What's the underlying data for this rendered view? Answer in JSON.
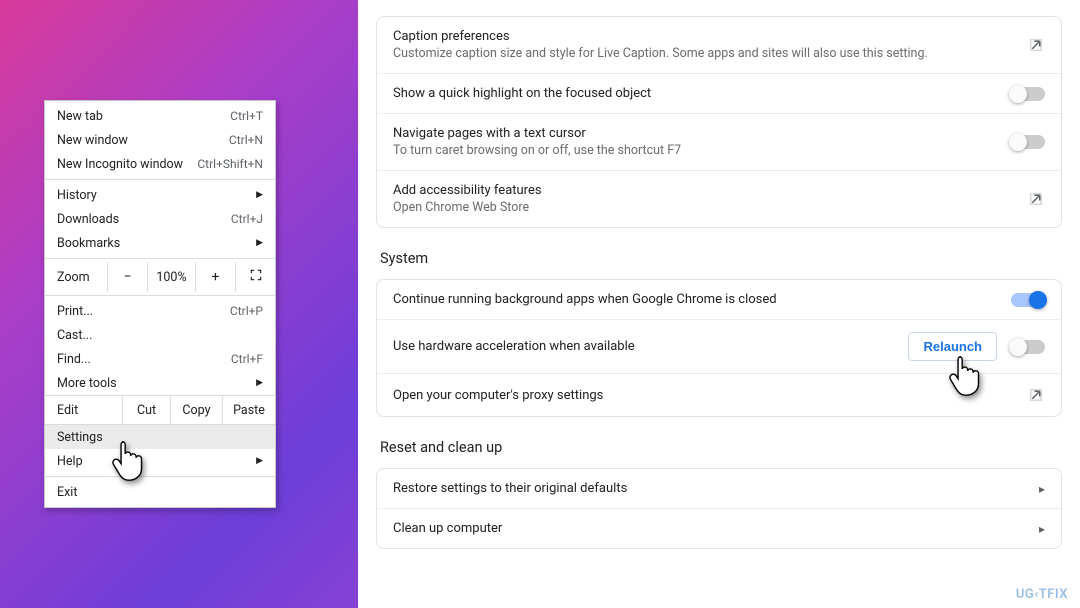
{
  "menu": {
    "newTab": {
      "label": "New tab",
      "shortcut": "Ctrl+T"
    },
    "newWindow": {
      "label": "New window",
      "shortcut": "Ctrl+N"
    },
    "newIncognito": {
      "label": "New Incognito window",
      "shortcut": "Ctrl+Shift+N"
    },
    "history": {
      "label": "History"
    },
    "downloads": {
      "label": "Downloads",
      "shortcut": "Ctrl+J"
    },
    "bookmarks": {
      "label": "Bookmarks"
    },
    "zoom": {
      "label": "Zoom",
      "minus": "−",
      "value": "100%",
      "plus": "+"
    },
    "print": {
      "label": "Print...",
      "shortcut": "Ctrl+P"
    },
    "cast": {
      "label": "Cast..."
    },
    "find": {
      "label": "Find...",
      "shortcut": "Ctrl+F"
    },
    "moreTools": {
      "label": "More tools"
    },
    "edit": {
      "label": "Edit",
      "cut": "Cut",
      "copy": "Copy",
      "paste": "Paste"
    },
    "settings": {
      "label": "Settings"
    },
    "help": {
      "label": "Help"
    },
    "exit": {
      "label": "Exit"
    }
  },
  "accessibility": {
    "captionPrefs": {
      "title": "Caption preferences",
      "sub": "Customize caption size and style for Live Caption. Some apps and sites will also use this setting."
    },
    "quickHighlight": {
      "title": "Show a quick highlight on the focused object",
      "on": false
    },
    "caretBrowsing": {
      "title": "Navigate pages with a text cursor",
      "sub": "To turn caret browsing on or off, use the shortcut F7",
      "on": false
    },
    "addFeatures": {
      "title": "Add accessibility features",
      "sub": "Open Chrome Web Store"
    }
  },
  "system": {
    "title": "System",
    "bgApps": {
      "title": "Continue running background apps when Google Chrome is closed",
      "on": true
    },
    "hwAccel": {
      "title": "Use hardware acceleration when available",
      "relaunch": "Relaunch",
      "on": false
    },
    "proxy": {
      "title": "Open your computer's proxy settings"
    }
  },
  "reset": {
    "title": "Reset and clean up",
    "restore": {
      "title": "Restore settings to their original defaults"
    },
    "cleanup": {
      "title": "Clean up computer"
    }
  },
  "watermark": "UG‹TFIX"
}
